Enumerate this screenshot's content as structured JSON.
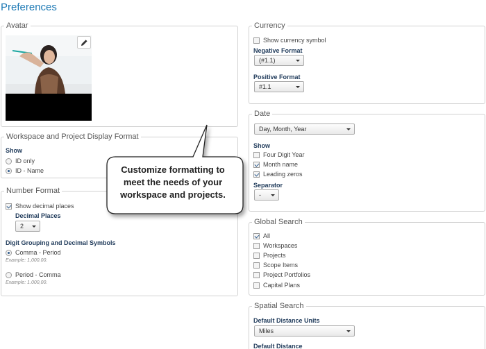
{
  "page": {
    "title": "Preferences"
  },
  "avatar": {
    "legend": "Avatar",
    "edit_icon": "pencil-icon"
  },
  "workspace_format": {
    "legend": "Workspace and Project Display Format",
    "show_label": "Show",
    "options": [
      {
        "label": "ID only",
        "selected": false
      },
      {
        "label": "ID - Name",
        "selected": true
      }
    ]
  },
  "number_format": {
    "legend": "Number Format",
    "show_decimal": {
      "label": "Show decimal places",
      "checked": true
    },
    "decimal_places_label": "Decimal Places",
    "decimal_places_value": "2",
    "grouping_label": "Digit Grouping and Decimal Symbols",
    "grouping_options": [
      {
        "label": "Comma - Period",
        "example": "Example: 1,000.00.",
        "selected": true
      },
      {
        "label": "Period - Comma",
        "example": "Example: 1.000,00.",
        "selected": false
      }
    ]
  },
  "currency": {
    "legend": "Currency",
    "show_symbol": {
      "label": "Show currency symbol",
      "checked": false
    },
    "negative_label": "Negative Format",
    "negative_value": "(#1.1)",
    "positive_label": "Positive Format",
    "positive_value": "#1.1"
  },
  "date": {
    "legend": "Date",
    "format_value": "Day, Month, Year",
    "show_label": "Show",
    "options": [
      {
        "label": "Four Digit Year",
        "checked": false
      },
      {
        "label": "Month name",
        "checked": true
      },
      {
        "label": "Leading zeros",
        "checked": true
      }
    ],
    "separator_label": "Separator",
    "separator_value": "-"
  },
  "global_search": {
    "legend": "Global Search",
    "options": [
      {
        "label": "All",
        "checked": true
      },
      {
        "label": "Workspaces",
        "checked": false
      },
      {
        "label": "Projects",
        "checked": false
      },
      {
        "label": "Scope Items",
        "checked": false
      },
      {
        "label": "Project Portfolios",
        "checked": false
      },
      {
        "label": "Capital Plans",
        "checked": false
      }
    ]
  },
  "spatial_search": {
    "legend": "Spatial Search",
    "units_label": "Default Distance Units",
    "units_value": "Miles",
    "distance_label": "Default Distance"
  },
  "callout": {
    "line1": "Customize formatting to",
    "line2": "meet the needs of your",
    "line3": "workspace and projects."
  },
  "colors": {
    "title": "#1b78b4",
    "accent": "#2c5a8c",
    "panel_border": "#d0d0d0"
  }
}
